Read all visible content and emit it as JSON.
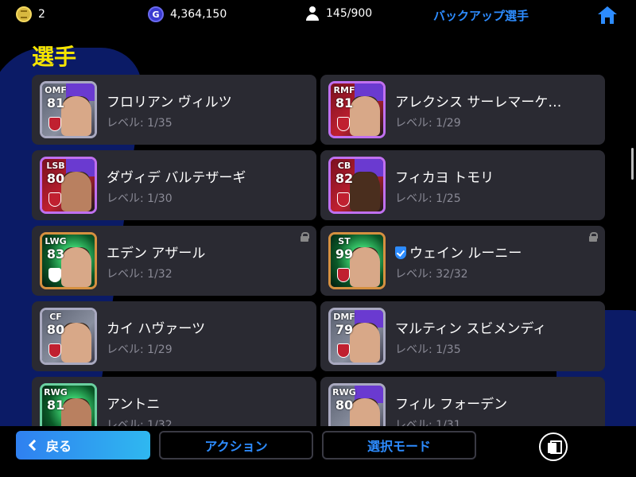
{
  "topbar": {
    "coins": "2",
    "gp": "4,364,150",
    "gp_icon_letter": "G",
    "squad_count": "145/900",
    "backup_label": "バックアップ選手"
  },
  "section_title": "選手",
  "players": [
    {
      "position": "OMF",
      "rating": "81",
      "name": "フロリアン ヴィルツ",
      "level": "レベル: 1/35",
      "locked": false,
      "verified": false
    },
    {
      "position": "RMF",
      "rating": "81",
      "name": "アレクシス サーレマーケ…",
      "level": "レベル: 1/29",
      "locked": false,
      "verified": false
    },
    {
      "position": "LSB",
      "rating": "80",
      "name": "ダヴィデ バルテザーギ",
      "level": "レベル: 1/30",
      "locked": false,
      "verified": false
    },
    {
      "position": "CB",
      "rating": "82",
      "name": "フィカヨ トモリ",
      "level": "レベル: 1/25",
      "locked": false,
      "verified": false
    },
    {
      "position": "LWG",
      "rating": "83",
      "name": "エデン アザール",
      "level": "レベル: 1/32",
      "locked": true,
      "verified": false
    },
    {
      "position": "ST",
      "rating": "99",
      "name": "ウェイン ルーニー",
      "level": "レベル: 32/32",
      "locked": true,
      "verified": true
    },
    {
      "position": "CF",
      "rating": "80",
      "name": "カイ ハヴァーツ",
      "level": "レベル: 1/29",
      "locked": false,
      "verified": false
    },
    {
      "position": "DMF",
      "rating": "79",
      "name": "マルティン スビメンディ",
      "level": "レベル: 1/35",
      "locked": false,
      "verified": false
    },
    {
      "position": "RWG",
      "rating": "81",
      "name": "アントニ",
      "level": "レベル: 1/32",
      "locked": false,
      "verified": false
    },
    {
      "position": "RWG",
      "rating": "80",
      "name": "フィル フォーデン",
      "level": "レベル: 1/31",
      "locked": false,
      "verified": false
    }
  ],
  "bottombar": {
    "back_label": "戻る",
    "action_label": "アクション",
    "select_mode_label": "選択モード"
  },
  "icons": {
    "coin": "coin-icon",
    "gp": "gp-icon",
    "squad": "person-icon",
    "home": "home-icon",
    "lock": "lock-icon",
    "verified": "shield-check-icon",
    "back": "chevron-left-icon",
    "copy": "copy-icon"
  },
  "colors": {
    "accent_blue": "#2d8cff",
    "title_yellow": "#f5e400",
    "card_bg": "#2a2a32"
  }
}
